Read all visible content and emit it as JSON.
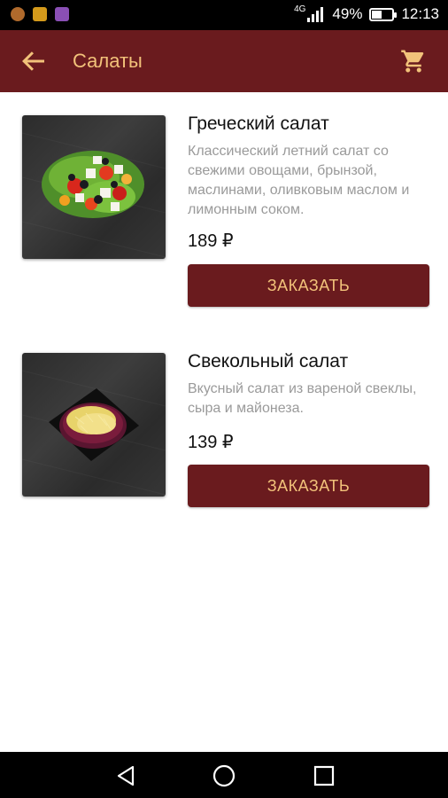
{
  "status_bar": {
    "network": "4G",
    "battery": "49%",
    "battery_level": 0.49,
    "time": "12:13",
    "notification_icons": [
      "food-app-icon",
      "market-app-icon",
      "viber-app-icon"
    ]
  },
  "app_bar": {
    "title": "Салаты",
    "back_icon": "arrow-back-icon",
    "cart_icon": "shopping-cart-icon"
  },
  "products": [
    {
      "name": "Греческий салат",
      "description": "Классический летний салат со свежими овощами, брынзой, маслинами, оливковым маслом и лимонным соком.",
      "price": "189 ₽",
      "button": "ЗАКАЗАТЬ",
      "image": "greek-salad-photo"
    },
    {
      "name": "Свекольный салат",
      "description": "Вкусный салат из вареной свеклы, сыра и майонеза.",
      "price": "139 ₽",
      "button": "ЗАКАЗАТЬ",
      "image": "beet-salad-photo"
    }
  ],
  "nav_bar": {
    "back": "nav-back-icon",
    "home": "nav-home-icon",
    "recents": "nav-recents-icon"
  },
  "colors": {
    "primary": "#6a1b1e",
    "accent": "#f2c27a",
    "description": "#9a9a9a"
  }
}
